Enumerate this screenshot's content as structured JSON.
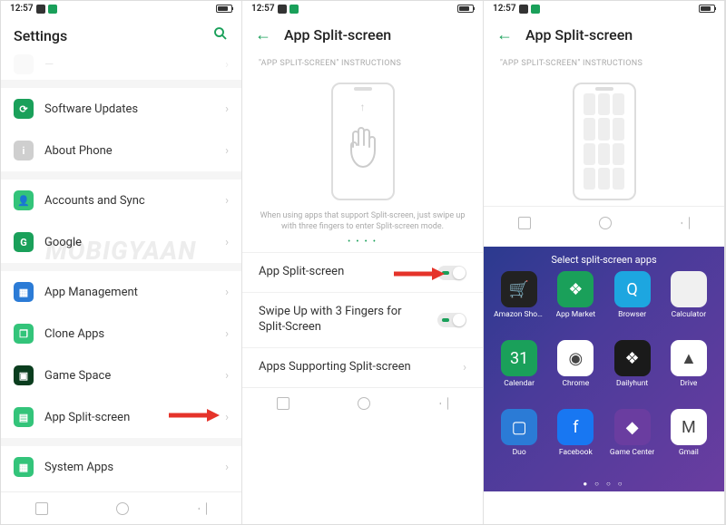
{
  "status": {
    "time": "12:57"
  },
  "watermark": "MOBIGYAAN",
  "screen1": {
    "title": "Settings",
    "items": [
      {
        "label": "Software Updates",
        "iconColor": "#1aa05a"
      },
      {
        "label": "About Phone",
        "iconColor": "#cfcfcf"
      }
    ],
    "items2": [
      {
        "label": "Accounts and Sync",
        "iconColor": "#33c47a"
      },
      {
        "label": "Google",
        "iconColor": "#1aa05a",
        "glyph": "G"
      }
    ],
    "items3": [
      {
        "label": "App Management",
        "iconColor": "#2b7bd6"
      },
      {
        "label": "Clone Apps",
        "iconColor": "#33c47a"
      },
      {
        "label": "Game Space",
        "iconColor": "#0a3d1e"
      },
      {
        "label": "App Split-screen",
        "iconColor": "#33c47a"
      }
    ],
    "items4": [
      {
        "label": "System Apps",
        "iconColor": "#33c47a"
      }
    ]
  },
  "screen2": {
    "title": "App Split-screen",
    "instructions": "\"APP SPLIT-SCREEN\" INSTRUCTIONS",
    "hint": "When using apps that support Split-screen, just swipe up with three fingers to enter Split-screen mode.",
    "toggle1": "App Split-screen",
    "toggle2": "Swipe Up with 3 Fingers for Split-Screen",
    "row3": "Apps Supporting Split-screen"
  },
  "screen3": {
    "title": "App Split-screen",
    "instructions": "\"APP SPLIT-SCREEN\" INSTRUCTIONS",
    "overlayTitle": "Select split-screen apps",
    "apps": [
      {
        "label": "Amazon Shop…",
        "bg": "#222",
        "glyph": "🛒"
      },
      {
        "label": "App Market",
        "bg": "#1aa05a",
        "glyph": "❖"
      },
      {
        "label": "Browser",
        "bg": "#1da6e0",
        "glyph": "Q"
      },
      {
        "label": "Calculator",
        "bg": "#f0f0f0",
        "glyph": ""
      },
      {
        "label": "Calendar",
        "bg": "#1aa05a",
        "glyph": "31"
      },
      {
        "label": "Chrome",
        "bg": "#fff",
        "glyph": "◉"
      },
      {
        "label": "Dailyhunt",
        "bg": "#1a1a1a",
        "glyph": "❖"
      },
      {
        "label": "Drive",
        "bg": "#fff",
        "glyph": "▲"
      },
      {
        "label": "Duo",
        "bg": "#2b7bd6",
        "glyph": "▢"
      },
      {
        "label": "Facebook",
        "bg": "#1877f2",
        "glyph": "f"
      },
      {
        "label": "Game Center",
        "bg": "#6a3da0",
        "glyph": "◆"
      },
      {
        "label": "Gmail",
        "bg": "#fff",
        "glyph": "M"
      }
    ]
  }
}
